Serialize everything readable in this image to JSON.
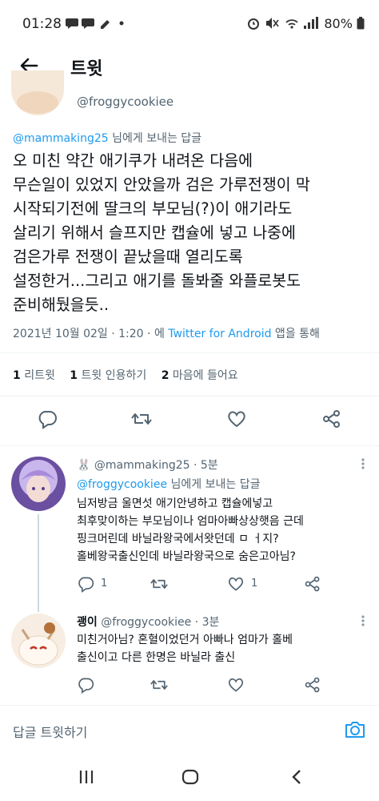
{
  "status_bar": {
    "time": "01:28",
    "left_icons": [
      "chat-bubble-icon",
      "chat-bubble-icon",
      "pencil-icon",
      "dot-icon"
    ],
    "right_icons": [
      "alarm-icon",
      "mute-icon",
      "wifi-icon",
      "signal-icon"
    ],
    "battery": "80%"
  },
  "header": {
    "title": "트윗"
  },
  "main_tweet": {
    "handle": "@froggycookiee",
    "reply_to_user": "@mammaking25",
    "reply_to_suffix": " 님에게 보내는 답글",
    "text": "오 미친 약간 애기쿠가 내려온 다음에\n무슨일이 있었지 안았을까 검은 가루전쟁이 막\n시작되기전에 딸크의 부모님(?)이 애기라도\n살리기 위해서 슬프지만 캡슐에 넣고 나중에\n검은가루 전쟁이 끝났을때 열리도록\n설정한거...그리고 애기를 돌봐줄 와플로봇도\n준비해뒀을듯..",
    "meta_date": "2021년 10월 02일 · 1:20 · 에 ",
    "meta_source": "Twitter for Android",
    "meta_suffix": " 앱을 통해",
    "stats": {
      "retweets_count": "1",
      "retweets_label": " 리트윗",
      "quotes_count": "1",
      "quotes_label": " 트윗 인용하기",
      "likes_count": "2",
      "likes_label": " 마음에 들어요"
    }
  },
  "replies": [
    {
      "emoji": "🐰",
      "name": "",
      "handle": "@mammaking25",
      "time": " · 5분",
      "reply_to_user": "@froggycookiee",
      "reply_to_suffix": " 님에게 보내는 답글",
      "text": "님저방금 울면섯 애기안녕하고 캡슐에넣고\n최후맞이하는 부모님이나 엄마아빠상상햇음 근데\n핑크머린데 바닐라왕국에서왓던데 ㅁ ㅓ지?\n홀베왕국출신인데 바닐라왕국으로 숨은고아님?",
      "reply_count": "1",
      "retweet_count": "",
      "like_count": "1"
    },
    {
      "emoji": "",
      "name": "괭이",
      "handle": " @froggycookiee",
      "time": " · 3분",
      "reply_to_user": "",
      "reply_to_suffix": "",
      "text": "미친거아님? 혼혈이었던거 아빠나 엄마가 홀베\n출신이고 다른 한명은 바닐라 출신",
      "reply_count": "",
      "retweet_count": "",
      "like_count": ""
    }
  ],
  "compose": {
    "placeholder": "답글 트윗하기"
  },
  "colors": {
    "accent": "#1d9bf0",
    "text": "#0f1419",
    "secondary": "#536471",
    "divider": "#eff3f4"
  }
}
